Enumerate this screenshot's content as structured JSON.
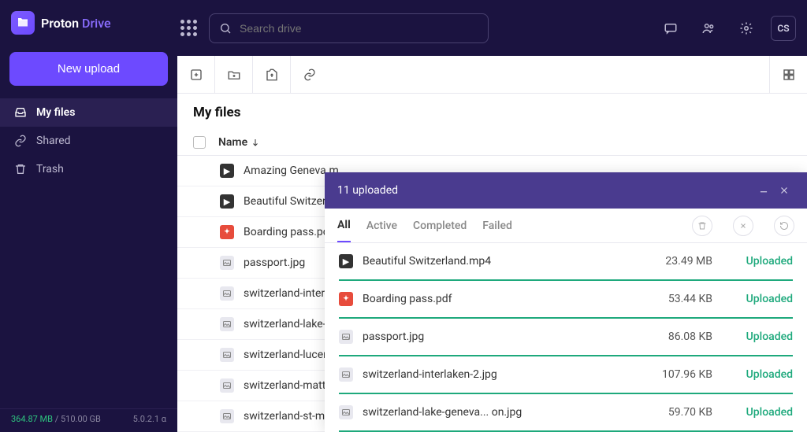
{
  "brand": {
    "name1": "Proton",
    "name2": "Drive"
  },
  "search": {
    "placeholder": "Search drive"
  },
  "avatar": "CS",
  "upload_button": "New upload",
  "nav": {
    "files": "My files",
    "shared": "Shared",
    "trash": "Trash"
  },
  "storage": {
    "used": "364.87 MB",
    "sep": " / ",
    "total": "510.00 GB",
    "version": "5.0.2.1 α"
  },
  "page_title": "My files",
  "columns": {
    "name": "Name"
  },
  "files": [
    {
      "name": "Amazing Geneva.m",
      "type": "vid"
    },
    {
      "name": "Beautiful Switzerla",
      "type": "vid"
    },
    {
      "name": "Boarding pass.pdf",
      "type": "pdf"
    },
    {
      "name": "passport.jpg",
      "type": "img"
    },
    {
      "name": "switzerland-interla",
      "type": "img"
    },
    {
      "name": "switzerland-lake-g",
      "type": "img"
    },
    {
      "name": "switzerland-lucern",
      "type": "img"
    },
    {
      "name": "switzerland-matte",
      "type": "img"
    },
    {
      "name": "switzerland-st-mo",
      "type": "img"
    }
  ],
  "panel": {
    "title": "11 uploaded",
    "tabs": {
      "all": "All",
      "active": "Active",
      "completed": "Completed",
      "failed": "Failed"
    },
    "items": [
      {
        "name": "Beautiful Switzerland.mp4",
        "size": "23.49 MB",
        "status": "Uploaded",
        "type": "vid"
      },
      {
        "name": "Boarding pass.pdf",
        "size": "53.44 KB",
        "status": "Uploaded",
        "type": "pdf"
      },
      {
        "name": "passport.jpg",
        "size": "86.08 KB",
        "status": "Uploaded",
        "type": "img"
      },
      {
        "name": "switzerland-interlaken-2.jpg",
        "size": "107.96 KB",
        "status": "Uploaded",
        "type": "img"
      },
      {
        "name": "switzerland-lake-geneva... on.jpg",
        "size": "59.70 KB",
        "status": "Uploaded",
        "type": "img"
      }
    ]
  }
}
